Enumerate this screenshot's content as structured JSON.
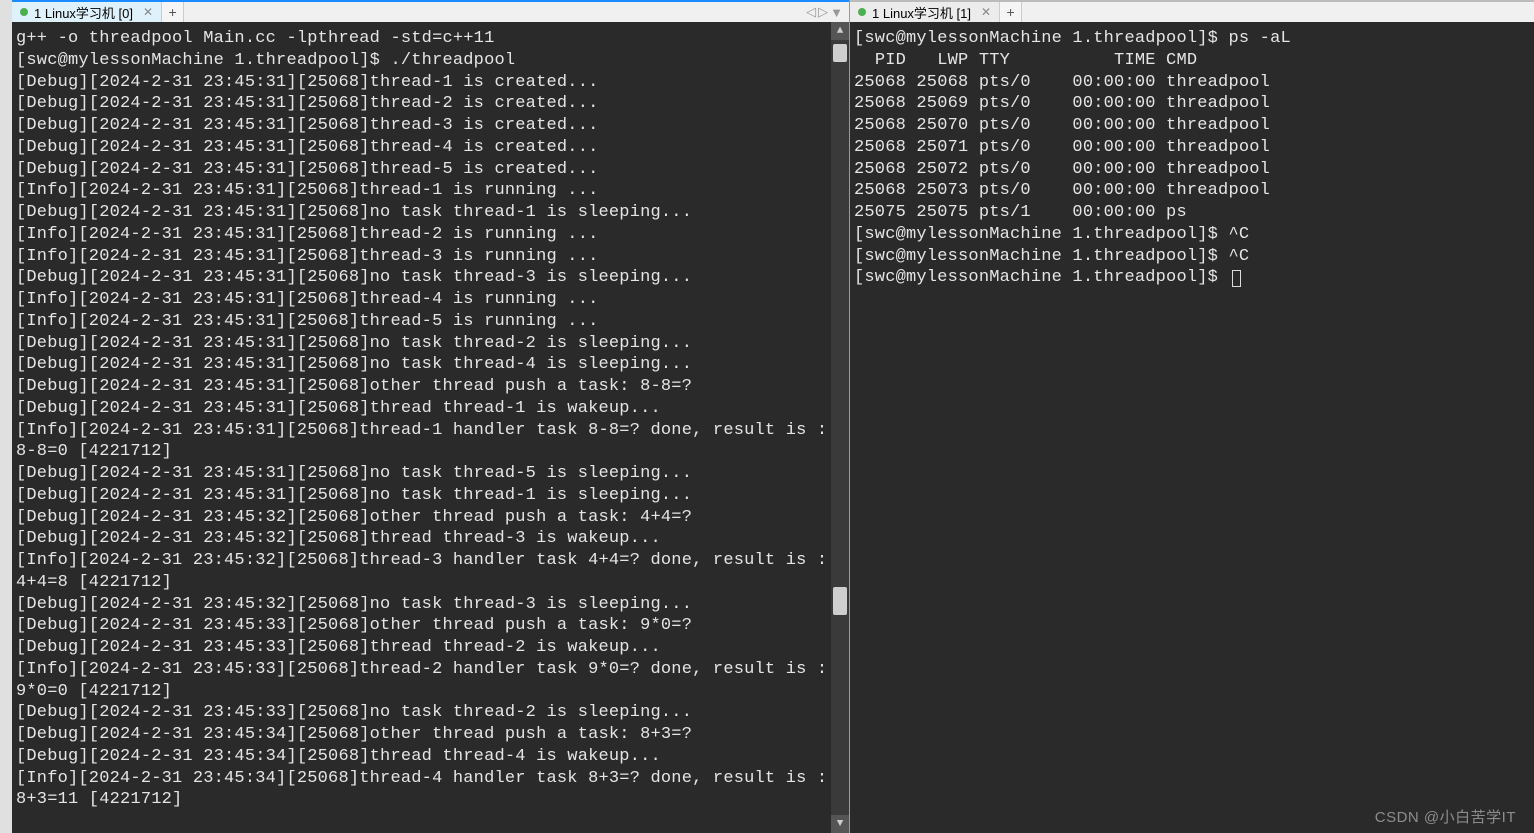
{
  "tabs": {
    "left": {
      "label": "1 Linux学习机 [0]"
    },
    "right": {
      "label": "1 Linux学习机 [1]"
    }
  },
  "nav": {
    "left": "◁",
    "right": "▷",
    "down": "▼"
  },
  "watermark": "CSDN @小白苦学IT",
  "left_terminal": {
    "lines": [
      "g++ -o threadpool Main.cc -lpthread -std=c++11",
      "[swc@mylessonMachine 1.threadpool]$ ./threadpool",
      "[Debug][2024-2-31 23:45:31][25068]thread-1 is created...",
      "[Debug][2024-2-31 23:45:31][25068]thread-2 is created...",
      "[Debug][2024-2-31 23:45:31][25068]thread-3 is created...",
      "[Debug][2024-2-31 23:45:31][25068]thread-4 is created...",
      "[Debug][2024-2-31 23:45:31][25068]thread-5 is created...",
      "[Info][2024-2-31 23:45:31][25068]thread-1 is running ...",
      "[Debug][2024-2-31 23:45:31][25068]no task thread-1 is sleeping...",
      "[Info][2024-2-31 23:45:31][25068]thread-2 is running ...",
      "[Info][2024-2-31 23:45:31][25068]thread-3 is running ...",
      "[Debug][2024-2-31 23:45:31][25068]no task thread-3 is sleeping...",
      "[Info][2024-2-31 23:45:31][25068]thread-4 is running ...",
      "[Info][2024-2-31 23:45:31][25068]thread-5 is running ...",
      "[Debug][2024-2-31 23:45:31][25068]no task thread-2 is sleeping...",
      "[Debug][2024-2-31 23:45:31][25068]no task thread-4 is sleeping...",
      "[Debug][2024-2-31 23:45:31][25068]other thread push a task: 8-8=?",
      "[Debug][2024-2-31 23:45:31][25068]thread thread-1 is wakeup...",
      "[Info][2024-2-31 23:45:31][25068]thread-1 handler task 8-8=? done, result is : 8-8=0 [4221712]",
      "[Debug][2024-2-31 23:45:31][25068]no task thread-5 is sleeping...",
      "[Debug][2024-2-31 23:45:31][25068]no task thread-1 is sleeping...",
      "[Debug][2024-2-31 23:45:32][25068]other thread push a task: 4+4=?",
      "[Debug][2024-2-31 23:45:32][25068]thread thread-3 is wakeup...",
      "[Info][2024-2-31 23:45:32][25068]thread-3 handler task 4+4=? done, result is : 4+4=8 [4221712]",
      "[Debug][2024-2-31 23:45:32][25068]no task thread-3 is sleeping...",
      "[Debug][2024-2-31 23:45:33][25068]other thread push a task: 9*0=?",
      "[Debug][2024-2-31 23:45:33][25068]thread thread-2 is wakeup...",
      "[Info][2024-2-31 23:45:33][25068]thread-2 handler task 9*0=? done, result is : 9*0=0 [4221712]",
      "[Debug][2024-2-31 23:45:33][25068]no task thread-2 is sleeping...",
      "[Debug][2024-2-31 23:45:34][25068]other thread push a task: 8+3=?",
      "[Debug][2024-2-31 23:45:34][25068]thread thread-4 is wakeup...",
      "[Info][2024-2-31 23:45:34][25068]thread-4 handler task 8+3=? done, result is : 8+3=11 [4221712]"
    ]
  },
  "right_terminal": {
    "prompt1": "[swc@mylessonMachine 1.threadpool]$ ps -aL",
    "header": "  PID   LWP TTY          TIME CMD",
    "rows": [
      "25068 25068 pts/0    00:00:00 threadpool",
      "25068 25069 pts/0    00:00:00 threadpool",
      "25068 25070 pts/0    00:00:00 threadpool",
      "25068 25071 pts/0    00:00:00 threadpool",
      "25068 25072 pts/0    00:00:00 threadpool",
      "25068 25073 pts/0    00:00:00 threadpool",
      "25075 25075 pts/1    00:00:00 ps"
    ],
    "prompt2": "[swc@mylessonMachine 1.threadpool]$ ^C",
    "prompt3": "[swc@mylessonMachine 1.threadpool]$ ^C",
    "prompt4": "[swc@mylessonMachine 1.threadpool]$ "
  }
}
